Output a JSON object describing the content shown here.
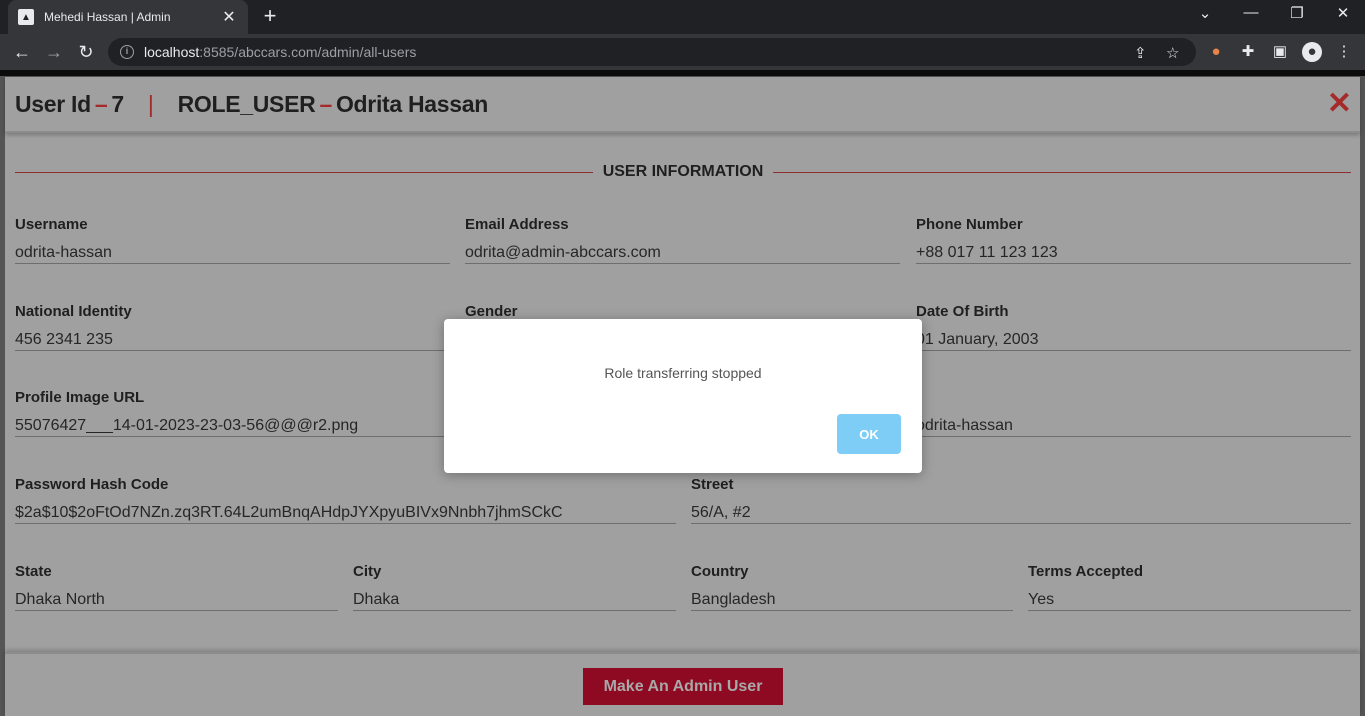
{
  "browser": {
    "tab_title": "Mehedi Hassan | Admin",
    "url_host": "localhost",
    "url_rest": ":8585/abccars.com/admin/all-users"
  },
  "icons": {
    "back": "arrow-left",
    "forward": "arrow-right",
    "reload": "reload",
    "info": "info-circle",
    "share": "share",
    "bookmark": "star",
    "cookie": "cookie",
    "extensions": "puzzle-piece",
    "sidepanel": "side-panel",
    "profile": "person",
    "menu": "three-dots",
    "close": "close-x"
  },
  "header": {
    "user_id_label": "User Id",
    "user_id_value": "7",
    "role": "ROLE_USER",
    "name": "Odrita Hassan"
  },
  "section": {
    "title": "USER INFORMATION"
  },
  "fields": {
    "username": {
      "label": "Username",
      "value": "odrita-hassan"
    },
    "email": {
      "label": "Email Address",
      "value": "odrita@admin-abccars.com"
    },
    "phone": {
      "label": "Phone Number",
      "value": "+88 017 11 123 123"
    },
    "national_id": {
      "label": "National Identity",
      "value": "456 2341 235"
    },
    "gender": {
      "label": "Gender",
      "value": ""
    },
    "dob": {
      "label": "Date Of Birth",
      "value": "01 January, 2003"
    },
    "profile_image": {
      "label": "Profile Image URL",
      "value": "55076427___14-01-2023-23-03-56@@@r2.png"
    },
    "hidden_field": {
      "label": "",
      "value": "odrita-hassan"
    },
    "password_hash": {
      "label": "Password Hash Code",
      "value": "$2a$10$2oFtOd7NZn.zq3RT.64L2umBnqAHdpJYXpyuBIVx9Nnbh7jhmSCkC"
    },
    "street": {
      "label": "Street",
      "value": "56/A, #2"
    },
    "state": {
      "label": "State",
      "value": "Dhaka North"
    },
    "city": {
      "label": "City",
      "value": "Dhaka"
    },
    "country": {
      "label": "Country",
      "value": "Bangladesh"
    },
    "terms": {
      "label": "Terms Accepted",
      "value": "Yes"
    }
  },
  "footer": {
    "make_admin_label": "Make An Admin User"
  },
  "alert": {
    "message": "Role transferring stopped",
    "ok_label": "OK"
  },
  "colors": {
    "accent_red": "#a52a2a",
    "button_red": "#8e0a22",
    "ok_blue": "#7dcdf7"
  }
}
